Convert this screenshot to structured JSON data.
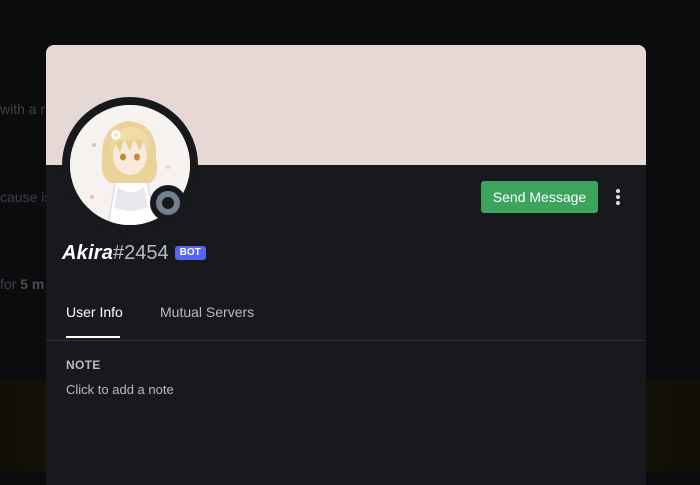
{
  "background": {
    "fragments": [
      {
        "text": "with a r",
        "bold": ""
      },
      {
        "text": "cause is",
        "bold": ""
      },
      {
        "text": "for ",
        "bold": "5 m"
      }
    ]
  },
  "profile": {
    "banner_color": "#e6d8d5",
    "username": "Akira",
    "discriminator": "#2454",
    "bot_tag": "BOT",
    "status": "offline"
  },
  "actions": {
    "send_message_label": "Send Message",
    "more_icon": "more-vertical-icon"
  },
  "tabs": [
    {
      "label": "User Info",
      "active": true
    },
    {
      "label": "Mutual Servers",
      "active": false
    }
  ],
  "note": {
    "label": "NOTE",
    "placeholder": "Click to add a note"
  },
  "colors": {
    "accent_green": "#3ba55d",
    "bot_tag": "#5865f2",
    "status_offline": "#747f8d"
  }
}
